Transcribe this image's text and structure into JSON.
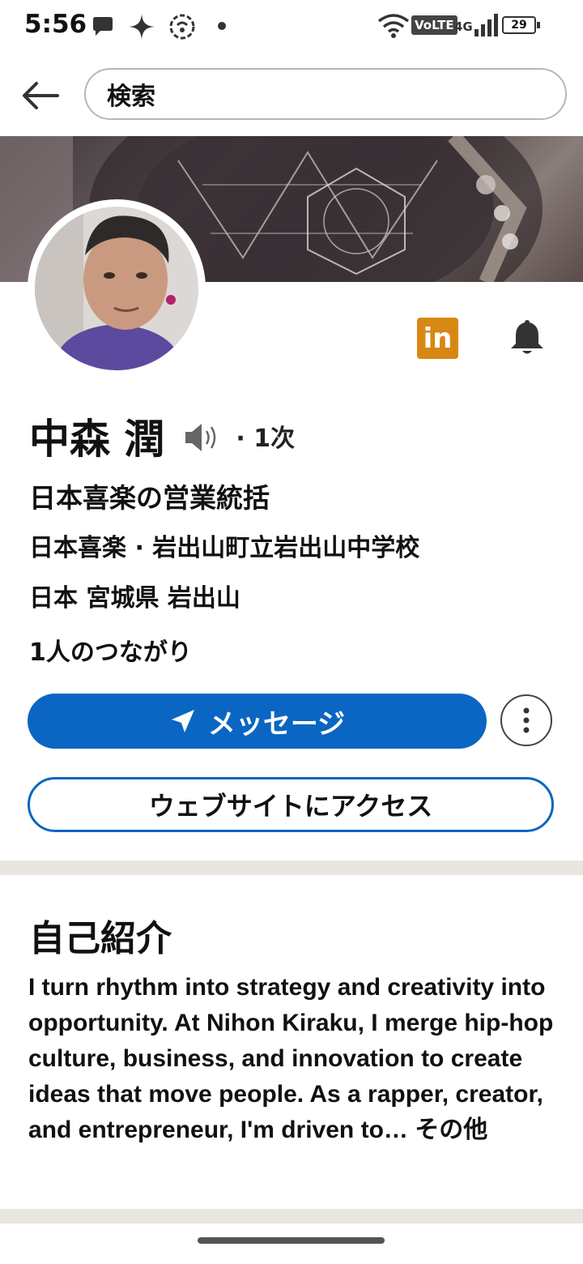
{
  "status_bar": {
    "time": "5:56",
    "network": "VoLTE",
    "signal": "4G",
    "battery": "29"
  },
  "search": {
    "value": "検索"
  },
  "profile": {
    "name": "中森 潤",
    "degree": "· 1次",
    "headline": "日本喜楽の営業統括",
    "company_school": "日本喜楽 · 岩出山町立岩出山中学校",
    "location": "日本 宮城県 岩出山",
    "connections": "1人のつながり",
    "linkedin_badge": "in"
  },
  "actions": {
    "message_label": "メッセージ",
    "website_label": "ウェブサイトにアクセス"
  },
  "about": {
    "title": "自己紹介",
    "text": "I turn rhythm into strategy and creativity into opportunity. At Nihon Kiraku, I merge hip-hop culture, business, and innovation to create ideas that move people. As a rapper, creator, and entrepreneur, I'm driven to…",
    "more_label": " その他"
  },
  "colors": {
    "primary": "#0a66c2",
    "linkedin_badge": "#d78814",
    "divider": "#e9e5df"
  }
}
